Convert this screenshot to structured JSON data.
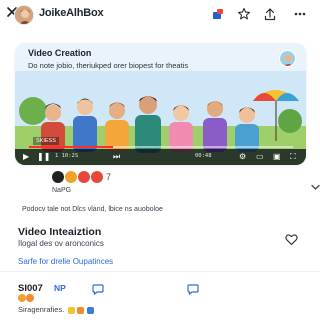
{
  "header": {
    "title": "JoikeAlhBox",
    "icons": [
      "close-icon",
      "app-logo",
      "media-icon",
      "star-icon",
      "share-icon",
      "more-icon"
    ]
  },
  "video": {
    "title": "Video Creation",
    "subtitle": "Do note jobio, theriukped orer biopest for theatis",
    "scene_caption": "SKIESS",
    "time_left": "1 10:2S",
    "time_right": "00:48",
    "progress": 0.32
  },
  "reactions": {
    "count": "7",
    "label": "NaPG",
    "colors": [
      "#222222",
      "#f2a12b",
      "#e8483a",
      "#e8483a"
    ]
  },
  "description": "Podocv tale not Dlcs vland, lbice ns auoboloe",
  "info": {
    "title": "Video Inteaiztion",
    "subtitle": "Ilogal des ov aronconics",
    "link": "Sarfe for drelie Oupatinces"
  },
  "comment": {
    "user": "SI007",
    "badge": "NP",
    "text": "Siragenrafies."
  },
  "colors": {
    "accent": "#2c6be0",
    "progress": "#ff2e2e",
    "card_bg": "#eaf3fb"
  }
}
